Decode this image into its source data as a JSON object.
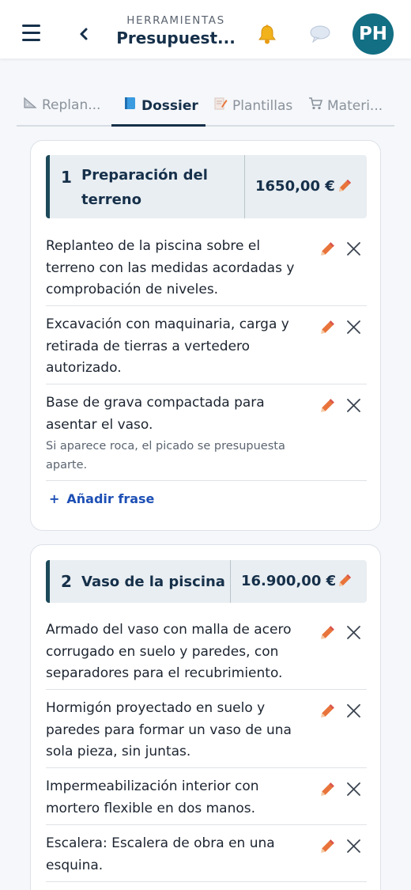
{
  "header": {
    "kicker": "HERRAMIENTAS",
    "title": "Presupuest...",
    "avatar_initials": "PH",
    "icons": {
      "menu": "hamburger-menu-icon",
      "back": "chevron-left-icon",
      "notifications": "bell-icon",
      "messages": "chat-bubble-icon"
    }
  },
  "tabs": [
    {
      "label": "Replan...",
      "icon": "set-square-icon",
      "active": false
    },
    {
      "label": "Dossier",
      "icon": "book-icon",
      "active": true
    },
    {
      "label": "Plantillas",
      "icon": "memo-pencil-icon",
      "active": false
    },
    {
      "label": "Materi...",
      "icon": "shopping-cart-icon",
      "active": false
    }
  ],
  "sections": [
    {
      "number": "1",
      "title": "Preparación del terreno",
      "amount": "1650,00 €",
      "items": [
        {
          "text": "Replanteo de la piscina sobre el terreno con las medidas acordadas y comprobación de niveles.",
          "note": ""
        },
        {
          "text": "Excavación con maquinaria, carga y retirada de tierras a vertedero autorizado.",
          "note": ""
        },
        {
          "text": "Base de grava compactada para asentar el vaso.",
          "note": "Si aparece roca, el picado se presupuesta aparte."
        }
      ],
      "add_label": "Añadir frase"
    },
    {
      "number": "2",
      "title": "Vaso de la piscina",
      "amount": "16.900,00 €",
      "items": [
        {
          "text": "Armado del vaso con malla de acero corrugado en suelo y paredes, con separadores para el recubrimiento.",
          "note": ""
        },
        {
          "text": "Hormigón proyectado en suelo y paredes para formar un vaso de una sola pieza, sin juntas.",
          "note": ""
        },
        {
          "text": "Impermeabilización interior con mortero flexible en dos manos.",
          "note": ""
        },
        {
          "text": "Escalera: Escalera de obra en una esquina.",
          "note": ""
        }
      ]
    }
  ],
  "colors": {
    "primary": "#16304a",
    "accent_link": "#1d4fb5",
    "avatar_bg": "#136f84",
    "edit_icon": "#e8743b"
  }
}
